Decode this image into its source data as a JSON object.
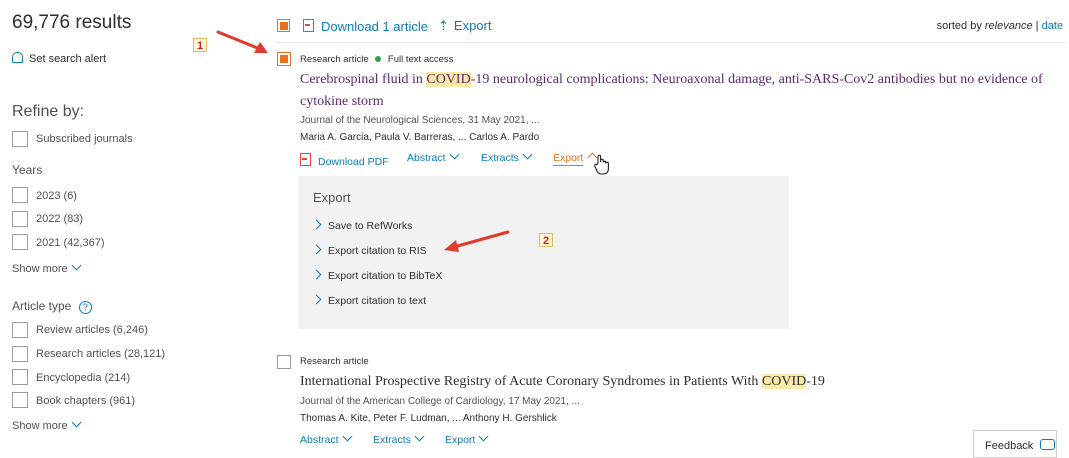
{
  "sidebar": {
    "results_count": "69,776 results",
    "set_alert": "Set search alert",
    "refine_by": "Refine by:",
    "subscribed": "Subscribed journals",
    "years_heading": "Years",
    "years": [
      "2023 (6)",
      "2022 (83)",
      "2021 (42,367)"
    ],
    "show_more_1": "Show more",
    "article_type_heading": "Article type",
    "article_types": [
      "Review articles (6,246)",
      "Research articles (28,121)",
      "Encyclopedia (214)",
      "Book chapters (961)"
    ],
    "show_more_2": "Show more"
  },
  "toolbar": {
    "download_label": "Download 1 article",
    "export_label": "Export",
    "sorted_by": "sorted by",
    "relevance": "relevance",
    "sep": "|",
    "date": "date"
  },
  "result1": {
    "type": "Research article",
    "access": "Full text access",
    "title_a": "Cerebrospinal fluid in ",
    "title_hl": "COVID",
    "title_b": "-19 neurological complications: Neuroaxonal damage, anti-SARS-Cov2 antibodies but no evidence of",
    "title_line2": "cytokine storm",
    "journal": "Journal of the Neurological Sciences, 31 May 2021, ...",
    "authors": "Maria A. Garcia, Paula V. Barreras, ... Carlos A. Pardo",
    "download_pdf": "Download PDF",
    "abstract": "Abstract",
    "extracts": "Extracts",
    "export": "Export"
  },
  "export_panel": {
    "heading": "Export",
    "options": [
      "Save to RefWorks",
      "Export citation to RIS",
      "Export citation to BibTeX",
      "Export citation to text"
    ]
  },
  "result2": {
    "type": "Research article",
    "title_a": "International Prospective Registry of Acute Coronary Syndromes in Patients With ",
    "title_hl": "COVID",
    "title_b": "-19",
    "journal": "Journal of the American College of Cardiology, 17 May 2021, ...",
    "authors": "Thomas A. Kite, Peter F. Ludman, ... Anthony H. Gershlick",
    "abstract": "Abstract",
    "extracts": "Extracts",
    "export": "Export"
  },
  "annotations": {
    "marker1": "1",
    "marker2": "2"
  },
  "feedback": "Feedback",
  "colors": {
    "accent": "#e9711c",
    "link": "#0c7dbb",
    "title": "#5b2a6b",
    "arrow": "#e03a30",
    "highlight": "#fde9a8"
  }
}
